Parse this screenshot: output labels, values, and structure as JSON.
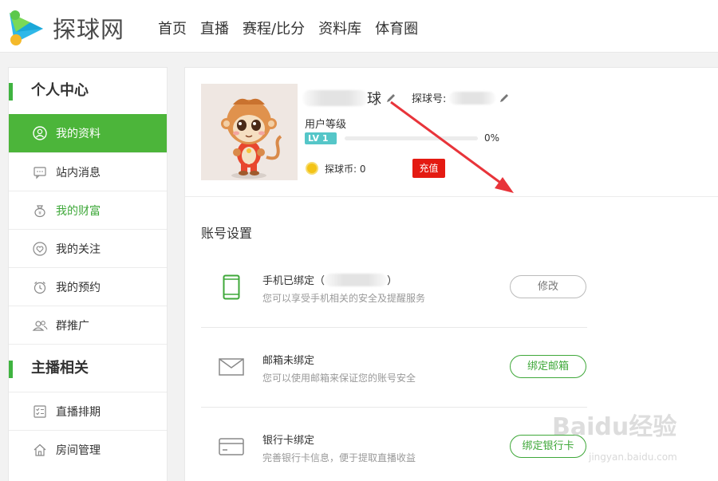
{
  "header": {
    "brand": "探球网",
    "nav": [
      "首页",
      "直播",
      "赛程/比分",
      "资料库",
      "体育圈"
    ]
  },
  "sidebar": {
    "section1_title": "个人中心",
    "items1": [
      {
        "label": "我的资料",
        "icon": "user-icon"
      },
      {
        "label": "站内消息",
        "icon": "message-icon"
      },
      {
        "label": "我的财富",
        "icon": "money-bag-icon"
      },
      {
        "label": "我的关注",
        "icon": "heart-icon"
      },
      {
        "label": "我的预约",
        "icon": "alarm-clock-icon"
      },
      {
        "label": "群推广",
        "icon": "group-icon"
      }
    ],
    "section2_title": "主播相关",
    "items2": [
      {
        "label": "直播排期",
        "icon": "schedule-icon"
      },
      {
        "label": "房间管理",
        "icon": "house-icon"
      }
    ]
  },
  "profile": {
    "username_suffix": "球",
    "id_label": "探球号:",
    "level_label": "用户等级",
    "level_badge": "LV 1",
    "level_progress": 0,
    "level_pct": "0%",
    "coin_text": "探球币: 0",
    "recharge_label": "充值"
  },
  "account": {
    "title": "账号设置",
    "rows": [
      {
        "title": "手机已绑定（",
        "title_end": "）",
        "desc": "您可以享受手机相关的安全及提醒服务",
        "button": "修改",
        "icon": "phone-icon"
      },
      {
        "title": "邮箱未绑定",
        "desc": "您可以使用邮箱来保证您的账号安全",
        "button": "绑定邮箱",
        "icon": "mail-icon"
      },
      {
        "title": "银行卡绑定",
        "desc": "完善银行卡信息，便于提取直播收益",
        "button": "绑定银行卡",
        "icon": "bank-card-icon"
      }
    ]
  },
  "watermark": {
    "main": "Baidu经验",
    "sub": "jingyan.baidu.com"
  },
  "colors": {
    "accent": "#4cb53a",
    "recharge": "#e41a12",
    "level": "#55c6c8",
    "arrow": "#e8343a"
  }
}
